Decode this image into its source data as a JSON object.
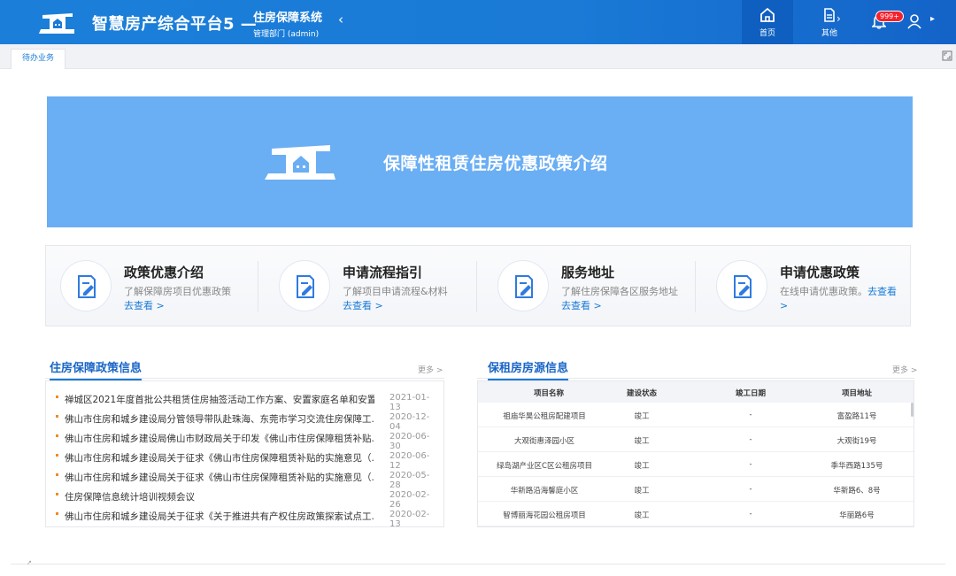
{
  "header": {
    "app_title": "智慧房产综合平台5 —",
    "system_name": "住房保障系统",
    "department": "管理部门 (admin)",
    "collapse_icon": "chevron-left-icon",
    "nav": [
      {
        "label": "首页",
        "icon": "home-icon",
        "active": true
      },
      {
        "label": "其他",
        "icon": "document-icon",
        "active": false
      }
    ],
    "notification_badge": "999+",
    "accent": "#1a7ad6"
  },
  "tabs": [
    {
      "label": "待办业务"
    }
  ],
  "banner": {
    "title": "保障性租赁住房优惠政策介绍",
    "color": "#6aaef4"
  },
  "cards": [
    {
      "title": "政策优惠介绍",
      "desc": "了解保障房项目优惠政策",
      "link": "去查看 >"
    },
    {
      "title": "申请流程指引",
      "desc": "了解项目申请流程&材料",
      "link": "去查看 >"
    },
    {
      "title": "服务地址",
      "desc": "了解住房保障各区服务地址",
      "link": "去查看 >"
    },
    {
      "title": "申请优惠政策",
      "desc": "在线申请优惠政策。",
      "link": "去查看 >"
    }
  ],
  "policy_panel": {
    "title": "住房保障政策信息",
    "more": "更多 >",
    "items": [
      {
        "text": "禅城区2021年度首批公共租赁住房抽签活动工作方案、安置家庭名单和安置...",
        "date": "2021-01-13"
      },
      {
        "text": "佛山市住房和城乡建设局分管领导带队赴珠海、东莞市学习交流住房保障工...",
        "date": "2020-12-04"
      },
      {
        "text": "佛山市住房和城乡建设局佛山市财政局关于印发《佛山市住房保障租赁补贴...",
        "date": "2020-06-30"
      },
      {
        "text": "佛山市住房和城乡建设局关于征求《佛山市住房保障租赁补贴的实施意见（...",
        "date": "2020-06-12"
      },
      {
        "text": "佛山市住房和城乡建设局关于征求《佛山市住房保障租赁补贴的实施意见（...",
        "date": "2020-05-28"
      },
      {
        "text": "住房保障信息统计培训视频会议",
        "date": "2020-02-26"
      },
      {
        "text": "佛山市住房和城乡建设局关于征求《关于推进共有产权住房政策探索试点工...",
        "date": "2020-02-13"
      }
    ]
  },
  "housing_panel": {
    "title": "保租房房源信息",
    "more": "更多 >",
    "columns": [
      "项目名称",
      "建设状态",
      "竣工日期",
      "项目地址"
    ],
    "rows": [
      [
        "祖庙华昊公租房配建项目",
        "竣工",
        "-",
        "富盈路11号"
      ],
      [
        "大观街惠泽园小区",
        "竣工",
        "-",
        "大观街19号"
      ],
      [
        "绿岛湖产业区C区公租房项目",
        "竣工",
        "-",
        "季华西路135号"
      ],
      [
        "华新路沿海馨庭小区",
        "竣工",
        "-",
        "华新路6、8号"
      ],
      [
        "智博丽海花园公租房项目",
        "竣工",
        "-",
        "华丽路6号"
      ]
    ]
  }
}
